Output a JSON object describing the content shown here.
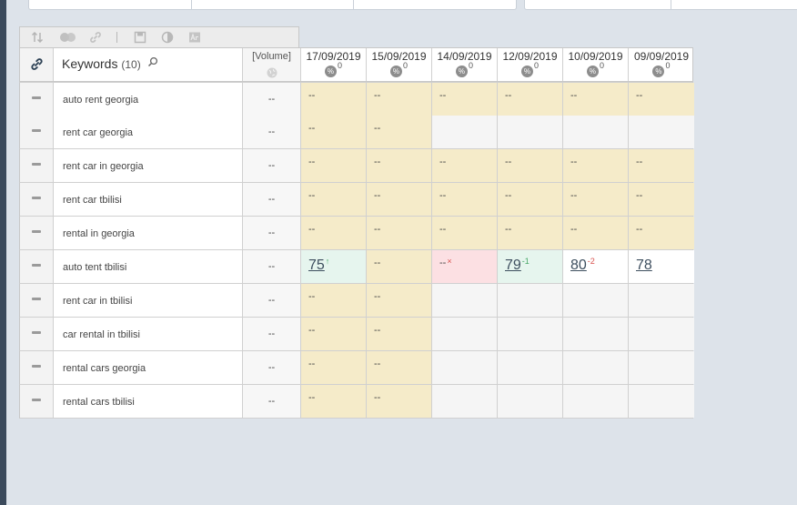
{
  "toolbar": {
    "icons": [
      "sort-icon",
      "toggle-icon",
      "link-icon",
      "save-icon",
      "contrast-icon",
      "font-icon"
    ]
  },
  "header": {
    "link_icon": "link-icon",
    "keywords_label": "Keywords",
    "keywords_count": "(10)",
    "volume_label": "[Volume]",
    "dates": [
      {
        "date": "17/09/2019",
        "pct": "0"
      },
      {
        "date": "15/09/2019",
        "pct": "0"
      },
      {
        "date": "14/09/2019",
        "pct": "0"
      },
      {
        "date": "12/09/2019",
        "pct": "0"
      },
      {
        "date": "10/09/2019",
        "pct": "0"
      },
      {
        "date": "09/09/2019",
        "pct": "0"
      }
    ],
    "pct_symbol": "%"
  },
  "colors": {
    "found": "#f5ebc9",
    "empty": "#f5f5f5",
    "improved": "#e6f5ee",
    "lost": "#fce0e3",
    "delta_up": "#49a868",
    "delta_down": "#d9534f"
  },
  "rows": [
    {
      "keyword": "auto rent georgia",
      "volume": "--",
      "cells": [
        {
          "val": "--",
          "state": "yellow"
        },
        {
          "val": "--",
          "state": "yellow"
        },
        {
          "val": "--",
          "state": "yellow"
        },
        {
          "val": "--",
          "state": "yellow"
        },
        {
          "val": "--",
          "state": "yellow"
        },
        {
          "val": "--",
          "state": "yellow"
        }
      ]
    },
    {
      "keyword": "rent car georgia",
      "volume": "--",
      "cells": [
        {
          "val": "--",
          "state": "yellow"
        },
        {
          "val": "--",
          "state": "yellow"
        },
        {
          "val": "",
          "state": "empty"
        },
        {
          "val": "",
          "state": "empty"
        },
        {
          "val": "",
          "state": "empty"
        },
        {
          "val": "",
          "state": "empty"
        }
      ]
    },
    {
      "keyword": "rent car in georgia",
      "volume": "--",
      "cells": [
        {
          "val": "--",
          "state": "yellow"
        },
        {
          "val": "--",
          "state": "yellow"
        },
        {
          "val": "--",
          "state": "yellow"
        },
        {
          "val": "--",
          "state": "yellow"
        },
        {
          "val": "--",
          "state": "yellow"
        },
        {
          "val": "--",
          "state": "yellow"
        }
      ]
    },
    {
      "keyword": "rent car tbilisi",
      "volume": "--",
      "cells": [
        {
          "val": "--",
          "state": "yellow"
        },
        {
          "val": "--",
          "state": "yellow"
        },
        {
          "val": "--",
          "state": "yellow"
        },
        {
          "val": "--",
          "state": "yellow"
        },
        {
          "val": "--",
          "state": "yellow"
        },
        {
          "val": "--",
          "state": "yellow"
        }
      ]
    },
    {
      "keyword": "rental in georgia",
      "volume": "--",
      "cells": [
        {
          "val": "--",
          "state": "yellow"
        },
        {
          "val": "--",
          "state": "yellow"
        },
        {
          "val": "--",
          "state": "yellow"
        },
        {
          "val": "--",
          "state": "yellow"
        },
        {
          "val": "--",
          "state": "yellow"
        },
        {
          "val": "--",
          "state": "yellow"
        }
      ]
    },
    {
      "keyword": "auto tent tbilisi",
      "volume": "--",
      "cells": [
        {
          "val": "75",
          "state": "green",
          "big": true,
          "delta": "↑",
          "dcolor": "green"
        },
        {
          "val": "--",
          "state": "yellow"
        },
        {
          "val": "--",
          "state": "pink",
          "delta": "×",
          "dcolor": "red"
        },
        {
          "val": "79",
          "state": "green",
          "big": true,
          "delta": "-1",
          "dcolor": "green"
        },
        {
          "val": "80",
          "state": "white",
          "big": true,
          "delta": "-2",
          "dcolor": "red"
        },
        {
          "val": "78",
          "state": "white",
          "big": true
        }
      ]
    },
    {
      "keyword": "rent car in tbilisi",
      "volume": "--",
      "cells": [
        {
          "val": "--",
          "state": "yellow"
        },
        {
          "val": "--",
          "state": "yellow"
        },
        {
          "val": "",
          "state": "empty"
        },
        {
          "val": "",
          "state": "empty"
        },
        {
          "val": "",
          "state": "empty"
        },
        {
          "val": "",
          "state": "empty"
        }
      ]
    },
    {
      "keyword": "car rental in tbilisi",
      "volume": "--",
      "cells": [
        {
          "val": "--",
          "state": "yellow"
        },
        {
          "val": "--",
          "state": "yellow"
        },
        {
          "val": "",
          "state": "empty"
        },
        {
          "val": "",
          "state": "empty"
        },
        {
          "val": "",
          "state": "empty"
        },
        {
          "val": "",
          "state": "empty"
        }
      ]
    },
    {
      "keyword": "rental cars georgia",
      "volume": "--",
      "cells": [
        {
          "val": "--",
          "state": "yellow"
        },
        {
          "val": "--",
          "state": "yellow"
        },
        {
          "val": "",
          "state": "empty"
        },
        {
          "val": "",
          "state": "empty"
        },
        {
          "val": "",
          "state": "empty"
        },
        {
          "val": "",
          "state": "empty"
        }
      ]
    },
    {
      "keyword": "rental cars tbilisi",
      "volume": "--",
      "cells": [
        {
          "val": "--",
          "state": "yellow"
        },
        {
          "val": "--",
          "state": "yellow"
        },
        {
          "val": "",
          "state": "empty"
        },
        {
          "val": "",
          "state": "empty"
        },
        {
          "val": "",
          "state": "empty"
        },
        {
          "val": "",
          "state": "empty"
        }
      ]
    }
  ]
}
